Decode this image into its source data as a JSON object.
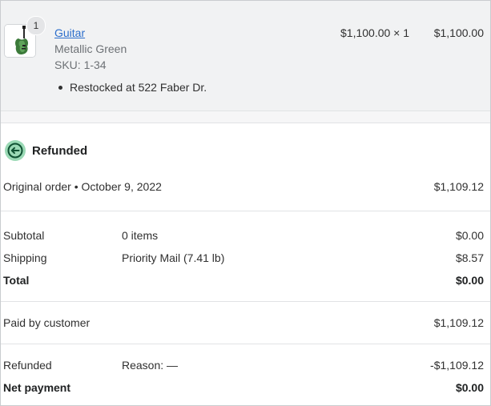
{
  "line_item": {
    "quantity": "1",
    "name": "Guitar",
    "variant": "Metallic Green",
    "sku": "SKU: 1-34",
    "restock_note": "Restocked at 522 Faber Dr.",
    "unit_price": "$1,100.00 × 1",
    "total": "$1,100.00",
    "thumbnail_icon": "guitar-thumbnail",
    "thumbnail_color": "#3c7a3a"
  },
  "refund": {
    "status_icon": "refund-arrow-icon",
    "status_color": "#9ad9b5",
    "status_title": "Refunded",
    "original_order_label": "Original order • October 9, 2022",
    "original_order_amount": "$1,109.12",
    "subtotal": {
      "label": "Subtotal",
      "detail": "0 items",
      "amount": "$0.00"
    },
    "shipping": {
      "label": "Shipping",
      "detail": "Priority Mail (7.41 lb)",
      "amount": "$8.57"
    },
    "total": {
      "label": "Total",
      "amount": "$0.00"
    },
    "paid_by_customer": {
      "label": "Paid by customer",
      "amount": "$1,109.12"
    },
    "refunded": {
      "label": "Refunded",
      "detail": "Reason: —",
      "amount": "-$1,109.12"
    },
    "net_payment": {
      "label": "Net payment",
      "amount": "$0.00"
    }
  }
}
